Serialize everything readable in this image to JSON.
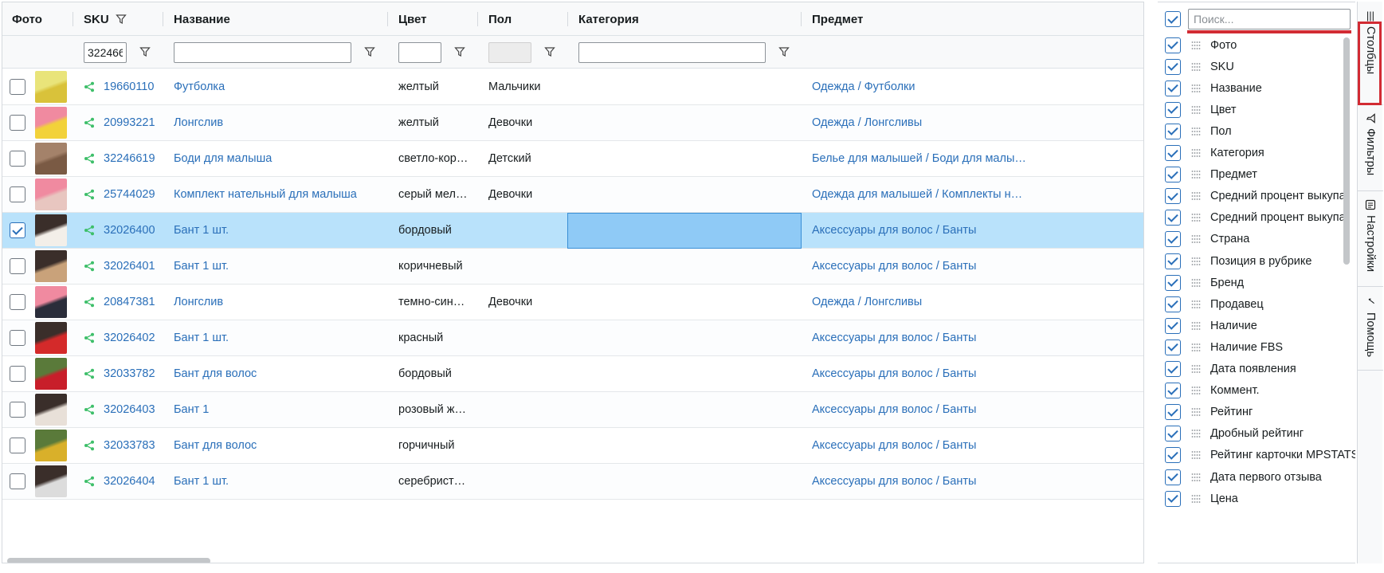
{
  "grid": {
    "headers": {
      "photo": "Фото",
      "sku": "SKU",
      "name": "Название",
      "color": "Цвет",
      "gender": "Пол",
      "category": "Категория",
      "subject": "Предмет"
    },
    "filters": {
      "sku_value": "322466",
      "name_value": "",
      "color_value": "",
      "category_value": ""
    },
    "rows": [
      {
        "sku": "19660110",
        "name": "Футболка",
        "color": "желтый",
        "gender": "Мальчики",
        "subject": "Одежда / Футболки",
        "checked": false,
        "thumb": "#e9e47a",
        "thumb2": "#d9c23a"
      },
      {
        "sku": "20993221",
        "name": "Лонгслив",
        "color": "желтый",
        "gender": "Девочки",
        "subject": "Одежда / Лонгсливы",
        "checked": false,
        "thumb": "#f08aa0",
        "thumb2": "#f2d23a"
      },
      {
        "sku": "32246619",
        "name": "Боди для малыша",
        "color": "светло-кор…",
        "gender": "Детский",
        "subject": "Белье для малышей / Боди для малы…",
        "checked": false,
        "thumb": "#a4826a",
        "thumb2": "#7a5a44"
      },
      {
        "sku": "25744029",
        "name": "Комплект нательный для малыша",
        "color": "серый мел…",
        "gender": "Девочки",
        "subject": "Одежда для малышей / Комплекты н…",
        "checked": false,
        "thumb": "#f08aa0",
        "thumb2": "#e8c6c0"
      },
      {
        "sku": "32026400",
        "name": "Бант 1 шт.",
        "color": "бордовый",
        "gender": "",
        "subject": "Аксессуары для волос / Банты",
        "checked": true,
        "thumb": "#3a2e2a",
        "thumb2": "#f3efe9"
      },
      {
        "sku": "32026401",
        "name": "Бант 1 шт.",
        "color": "коричневый",
        "gender": "",
        "subject": "Аксессуары для волос / Банты",
        "checked": false,
        "thumb": "#3a2e2a",
        "thumb2": "#c9a27a"
      },
      {
        "sku": "20847381",
        "name": "Лонгслив",
        "color": "темно-син…",
        "gender": "Девочки",
        "subject": "Одежда / Лонгсливы",
        "checked": false,
        "thumb": "#f08aa0",
        "thumb2": "#2a2d3a"
      },
      {
        "sku": "32026402",
        "name": "Бант 1 шт.",
        "color": "красный",
        "gender": "",
        "subject": "Аксессуары для волос / Банты",
        "checked": false,
        "thumb": "#3a2e2a",
        "thumb2": "#d42a2a"
      },
      {
        "sku": "32033782",
        "name": "Бант для волос",
        "color": "бордовый",
        "gender": "",
        "subject": "Аксессуары для волос / Банты",
        "checked": false,
        "thumb": "#5a7a3a",
        "thumb2": "#c81e2a"
      },
      {
        "sku": "32026403",
        "name": "Бант 1",
        "color": "розовый ж…",
        "gender": "",
        "subject": "Аксессуары для волос / Банты",
        "checked": false,
        "thumb": "#3a2e2a",
        "thumb2": "#e8e0d8"
      },
      {
        "sku": "32033783",
        "name": "Бант для волос",
        "color": "горчичный",
        "gender": "",
        "subject": "Аксессуары для волос / Банты",
        "checked": false,
        "thumb": "#5a7a3a",
        "thumb2": "#d9b02a"
      },
      {
        "sku": "32026404",
        "name": "Бант 1 шт.",
        "color": "серебрист…",
        "gender": "",
        "subject": "Аксессуары для волос / Банты",
        "checked": false,
        "thumb": "#3a2e2a",
        "thumb2": "#dcdcdc"
      }
    ]
  },
  "columns_panel": {
    "search_placeholder": "Поиск...",
    "items": [
      "Фото",
      "SKU",
      "Название",
      "Цвет",
      "Пол",
      "Категория",
      "Предмет",
      "Средний процент выкупа",
      "Средний процент выкупа",
      "Страна",
      "Позиция в рубрике",
      "Бренд",
      "Продавец",
      "Наличие",
      "Наличие FBS",
      "Дата появления",
      "Коммент.",
      "Рейтинг",
      "Дробный рейтинг",
      "Рейтинг карточки MPSTATS",
      "Дата первого отзыва",
      "Цена"
    ]
  },
  "side_tabs": {
    "columns": "Столбцы",
    "filters": "Фильтры",
    "settings": "Настройки",
    "help": "Помощь"
  },
  "colors": {
    "link": "#2a6fb9",
    "share": "#3ebf6a",
    "selected_row": "#b9e2fb",
    "highlight": "#d22b33"
  }
}
